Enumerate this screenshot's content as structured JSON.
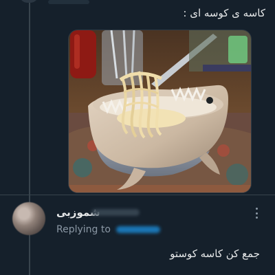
{
  "tweet": {
    "text": "کاسه ی کوسه ای :"
  },
  "reply": {
    "display_name": "شموزبی",
    "replying_to_label": "Replying to",
    "text": "جمع کن کاسه کوستو"
  },
  "colors": {
    "background": "#15202b",
    "thread_line": "#38444d",
    "muted_text": "#8b98a5",
    "link": "#1d9bf0"
  },
  "icons": {
    "more": "more-vertical-icon"
  }
}
